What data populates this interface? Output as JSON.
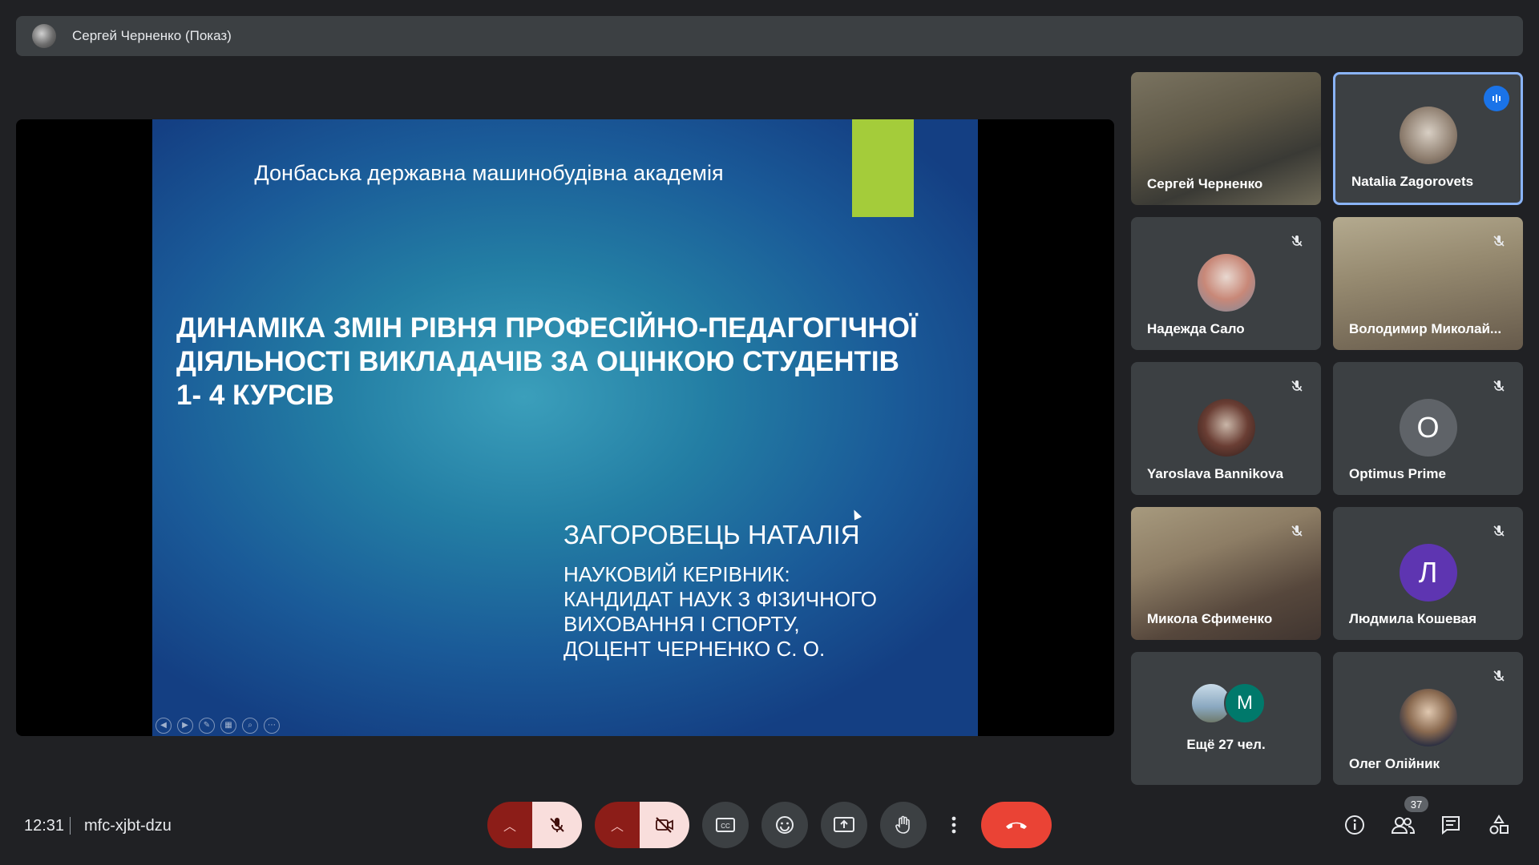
{
  "header": {
    "presenter_label": "Сергей Черненко (Показ)"
  },
  "presentation": {
    "institution": "Донбаська державна машинобудівна академія",
    "title_lines": [
      "ДИНАМІКА ЗМІН РІВНЯ ПРОФЕСІЙНО-ПЕДАГОГІЧНОЇ",
      "ДІЯЛЬНОСТІ ВИКЛАДАЧІВ ЗА ОЦІНКОЮ СТУДЕНТІВ",
      "1- 4 КУРСІВ"
    ],
    "author": "ЗАГОРОВЕЦЬ НАТАЛІЯ",
    "supervisor_lines": [
      "НАУКОВИЙ КЕРІВНИК:",
      "КАНДИДАТ НАУК З ФІЗИЧНОГО",
      "ВИХОВАННЯ І СПОРТУ,",
      "ДОЦЕНТ ЧЕРНЕНКО С. О."
    ],
    "accent_color": "#a4cc3a"
  },
  "participants": [
    {
      "name": "Сергей Черненко"
    },
    {
      "name": "Natalia Zagorovets"
    },
    {
      "name": "Надежда Сало"
    },
    {
      "name": "Володимир Миколай..."
    },
    {
      "name": "Yaroslava Bannikova"
    },
    {
      "name": "Optimus Prime",
      "initial": "O"
    },
    {
      "name": "Микола Єфименко"
    },
    {
      "name": "Людмила Кошевая",
      "initial": "Л"
    },
    {
      "overflow_label": "Ещё 27 чел.",
      "initial": "M"
    },
    {
      "name": "Олег Олійник"
    }
  ],
  "footer": {
    "time": "12:31",
    "meeting_code": "mfc-xjbt-dzu",
    "participant_count": "37"
  },
  "colors": {
    "hangup": "#ea4335",
    "muted_button_bg": "#f9dedc",
    "active_speaker_border": "#8ab4f8"
  }
}
